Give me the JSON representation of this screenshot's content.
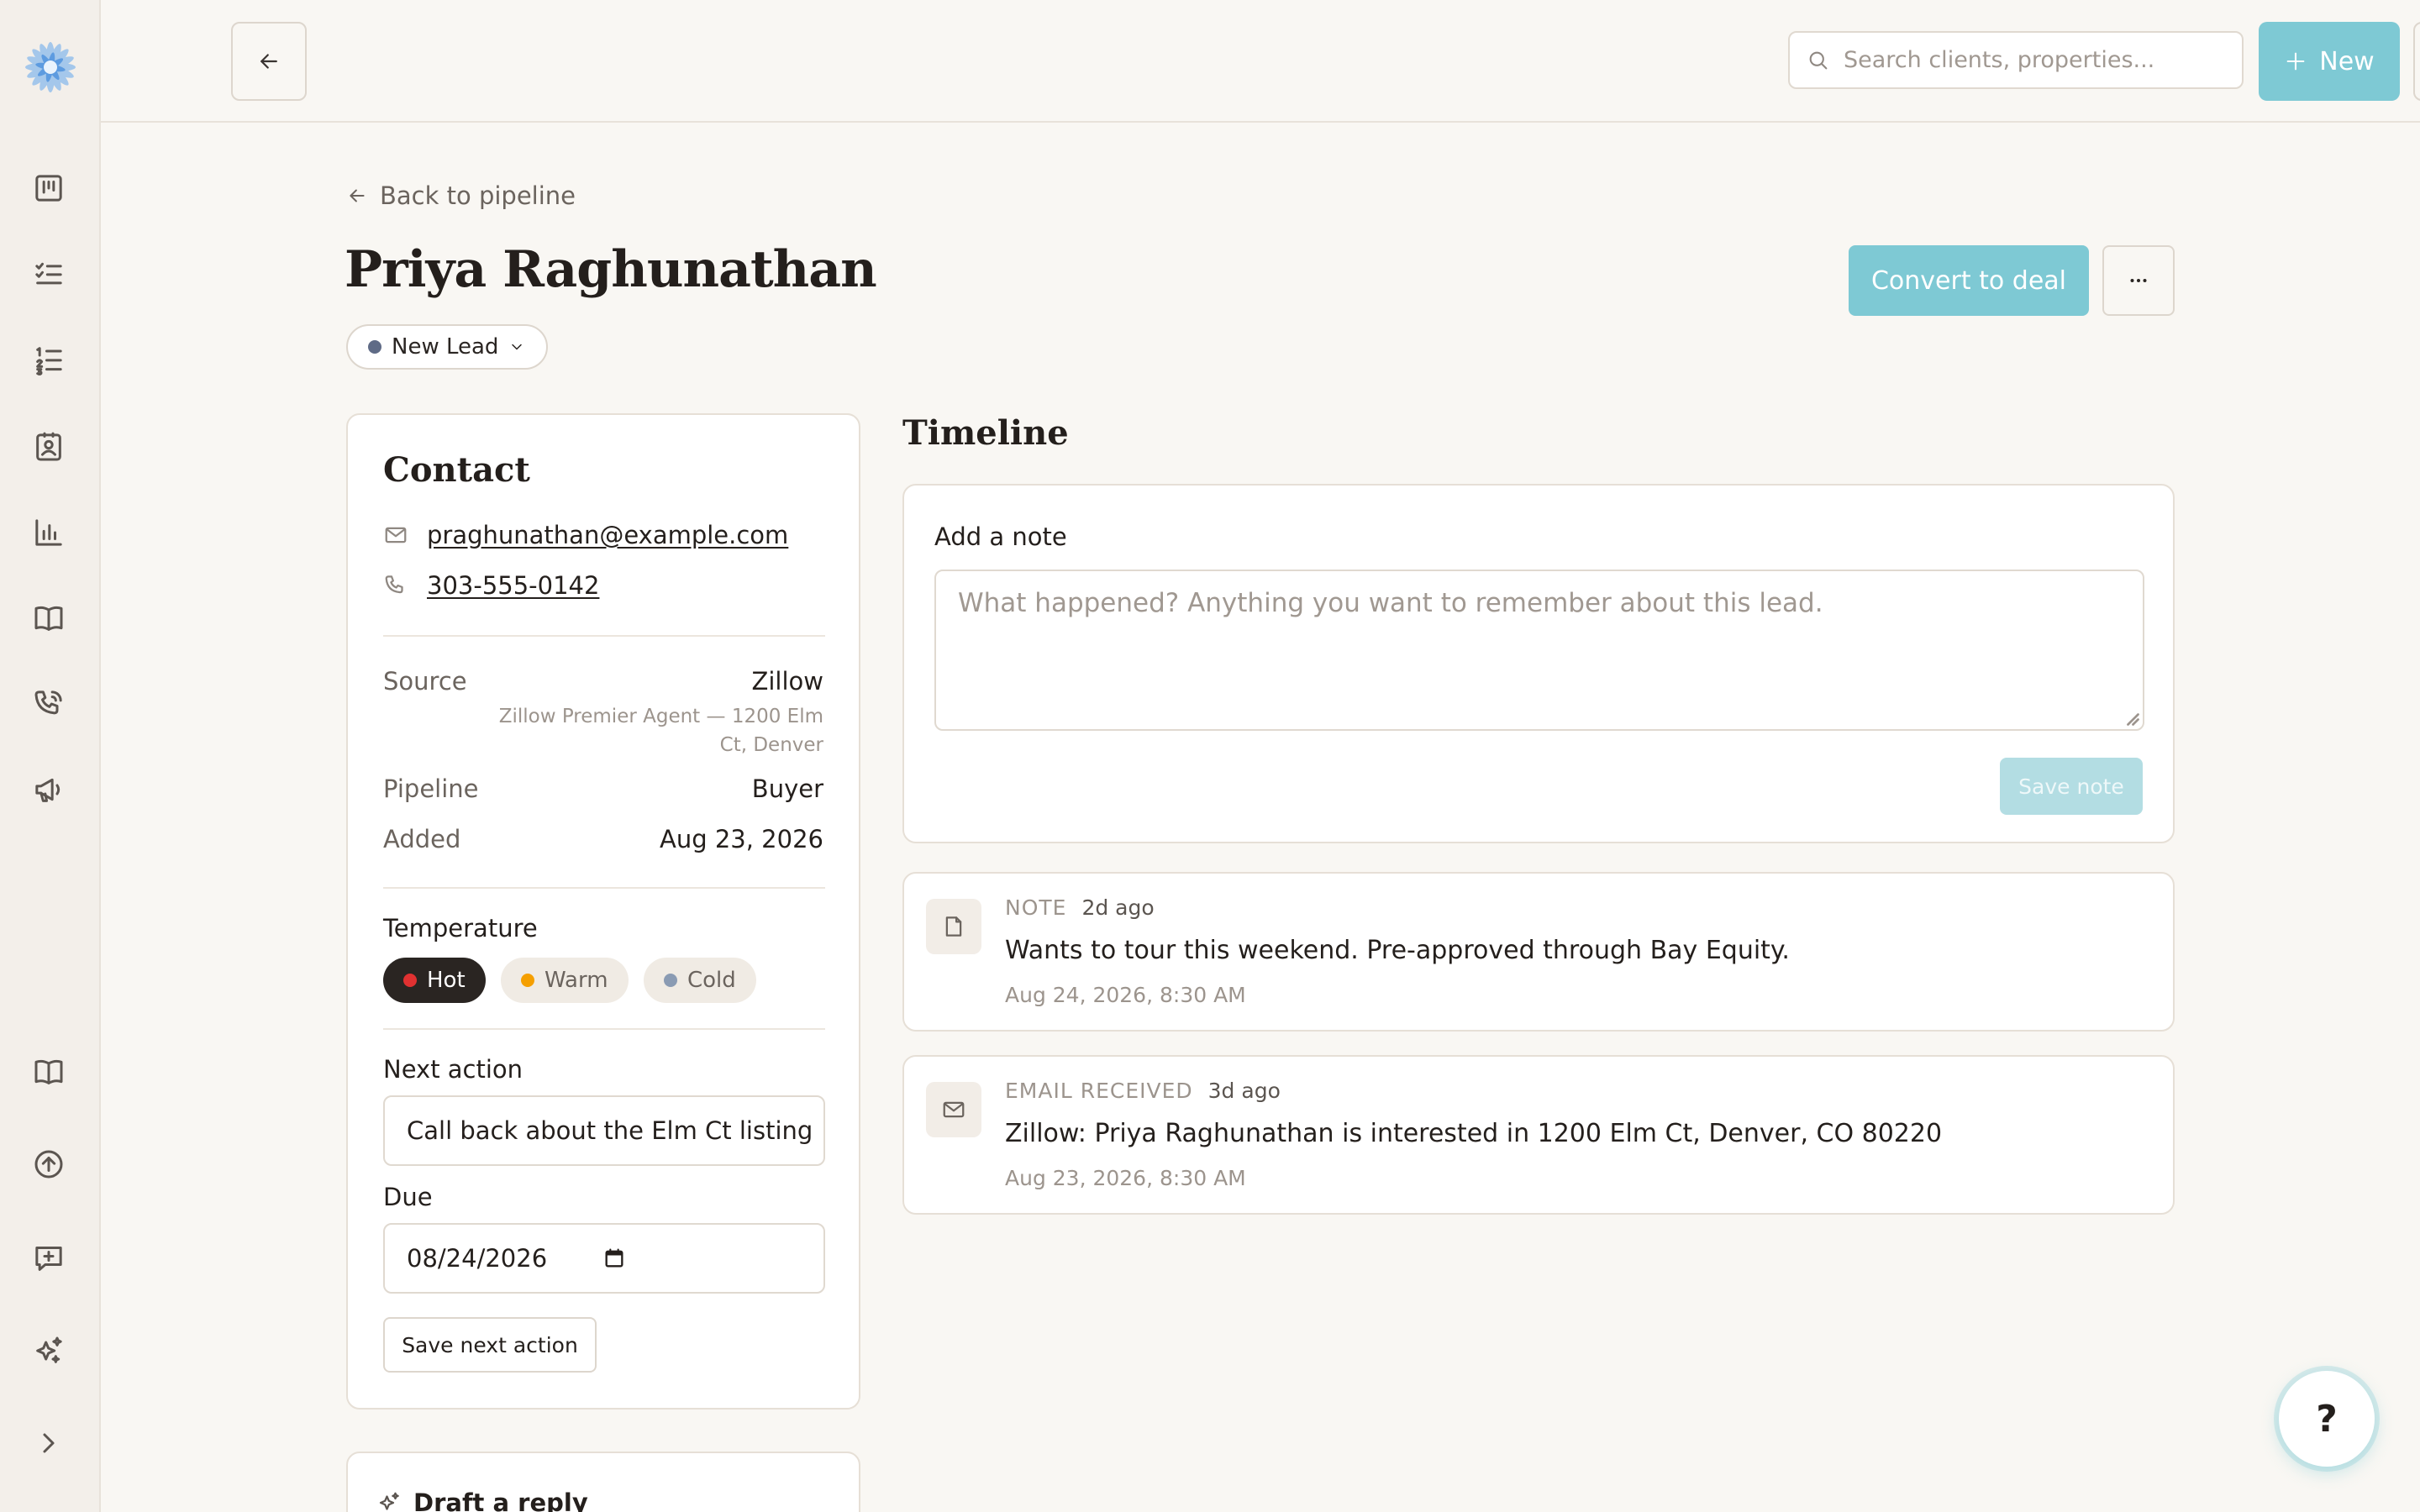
{
  "topbar": {
    "search_placeholder": "Search clients, properties...",
    "new_label": "New"
  },
  "header": {
    "back_link": "Back to pipeline",
    "title": "Priya Raghunathan",
    "stage": "New Lead",
    "convert_label": "Convert to deal"
  },
  "contact": {
    "title": "Contact",
    "email": "praghunathan@example.com",
    "phone": "303-555-0142",
    "source_label": "Source",
    "source_value": "Zillow",
    "source_detail": "Zillow Premier Agent — 1200 Elm Ct, Denver",
    "pipeline_label": "Pipeline",
    "pipeline_value": "Buyer",
    "added_label": "Added",
    "added_value": "Aug 23, 2026",
    "temperature_label": "Temperature",
    "temperatures": [
      {
        "label": "Hot",
        "selected": true,
        "color": "#e03131"
      },
      {
        "label": "Warm",
        "selected": false,
        "color": "#f59f00"
      },
      {
        "label": "Cold",
        "selected": false,
        "color": "#8a9bb3"
      }
    ],
    "next_action_label": "Next action",
    "next_action_value": "Call back about the Elm Ct listing",
    "due_label": "Due",
    "due_value": "08/24/2026",
    "save_next_action_label": "Save next action"
  },
  "draft": {
    "title": "Draft a reply"
  },
  "timeline": {
    "title": "Timeline",
    "add_note_label": "Add a note",
    "note_placeholder": "What happened? Anything you want to remember about this lead.",
    "save_note_label": "Save note",
    "events": [
      {
        "kind": "NOTE",
        "ago": "2d ago",
        "text": "Wants to tour this weekend. Pre-approved through Bay Equity.",
        "time": "Aug 24, 2026, 8:30 AM",
        "icon": "note-icon"
      },
      {
        "kind": "EMAIL RECEIVED",
        "ago": "3d ago",
        "text": "Zillow: Priya Raghunathan is interested in 1200 Elm Ct, Denver, CO 80220",
        "time": "Aug 23, 2026, 8:30 AM",
        "icon": "mail-icon"
      }
    ]
  },
  "help": {
    "label": "?"
  },
  "colors": {
    "accent": "#7ec9d4",
    "accent_disabled": "#b3dde3",
    "background": "#f9f7f3",
    "sidebar": "#f3efea",
    "stage_dot": "#5f6b86",
    "hot_chip_bg": "#2a2522"
  }
}
